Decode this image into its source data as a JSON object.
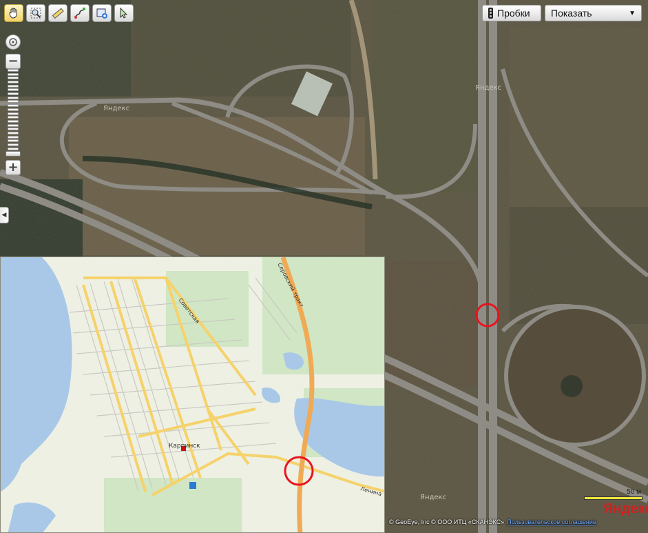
{
  "toolbar": {
    "tools": [
      {
        "name": "hand",
        "active": true
      },
      {
        "name": "magnifier",
        "active": false
      },
      {
        "name": "ruler",
        "active": false
      },
      {
        "name": "route",
        "active": false
      },
      {
        "name": "add-object",
        "active": false
      },
      {
        "name": "select",
        "active": false
      }
    ]
  },
  "zoom": {
    "plus": "+",
    "minus": "−",
    "level_fraction": 0.95
  },
  "traffic_button": {
    "label": "Пробки",
    "icon": "traffic-light-icon"
  },
  "layer_select": {
    "label": "Показать",
    "icon": "chevron-down-icon"
  },
  "map_labels": {
    "watermark": "Яндекс",
    "inset_labels": [
      "Карпинск",
      "Серовский тракт",
      "Советская",
      "Ленина"
    ]
  },
  "scale": {
    "label": "50 м"
  },
  "logo": {
    "text": "Яндекс"
  },
  "copyright": {
    "text": "© GeoEye, Inc © ООО ИТЦ «СКАНЭКС»",
    "link": "Пользовательское соглашение"
  },
  "colors": {
    "accent": "#e8141e",
    "road": "#9a9890",
    "inset_road": "#f5d26a",
    "inset_water": "#a9c8e8"
  }
}
